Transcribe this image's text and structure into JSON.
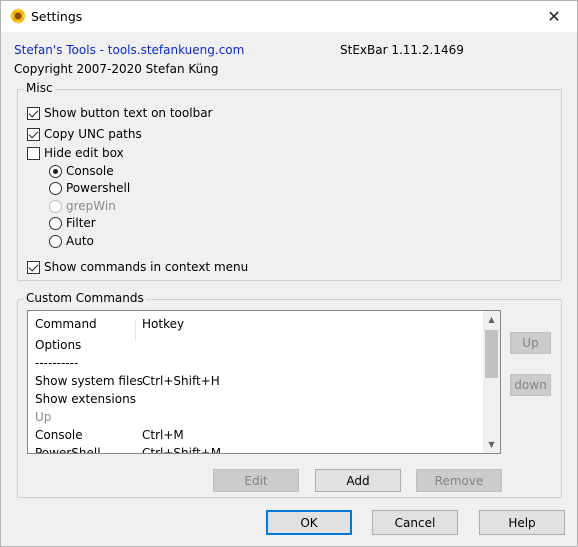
{
  "window": {
    "title": "Settings",
    "close_glyph": "✕"
  },
  "header": {
    "link": "Stefan's Tools - tools.stefankueng.com",
    "version": "StExBar 1.11.2.1469",
    "copyright": "Copyright 2007-2020 Stefan Küng"
  },
  "misc": {
    "label": "Misc",
    "show_button_text": {
      "label": "Show button text on toolbar",
      "checked": true
    },
    "copy_unc": {
      "label": "Copy UNC paths",
      "checked": true
    },
    "hide_edit": {
      "label": "Hide edit box",
      "checked": false
    },
    "radios": [
      {
        "label": "Console",
        "checked": true,
        "enabled": true
      },
      {
        "label": "Powershell",
        "checked": false,
        "enabled": true
      },
      {
        "label": "grepWin",
        "checked": false,
        "enabled": false
      },
      {
        "label": "Filter",
        "checked": false,
        "enabled": true
      },
      {
        "label": "Auto",
        "checked": false,
        "enabled": true
      }
    ],
    "show_commands": {
      "label": "Show commands in context menu",
      "checked": true
    }
  },
  "custom": {
    "label": "Custom Commands",
    "header": {
      "col1": "Command",
      "col2": "Hotkey"
    },
    "rows": [
      {
        "command": "Options",
        "hotkey": ""
      },
      {
        "command": "----------",
        "hotkey": ""
      },
      {
        "command": "Show system files",
        "hotkey": "Ctrl+Shift+H"
      },
      {
        "command": "Show extensions",
        "hotkey": ""
      },
      {
        "command": "Up",
        "hotkey": ""
      },
      {
        "command": "Console",
        "hotkey": "Ctrl+M"
      },
      {
        "command": "PowerShell",
        "hotkey": "Ctrl+Shift+M"
      }
    ],
    "up_label": "Up",
    "down_label": "down",
    "edit_label": "Edit",
    "add_label": "Add",
    "remove_label": "Remove"
  },
  "footer": {
    "ok_label": "OK",
    "cancel_label": "Cancel",
    "help_label": "Help"
  },
  "colors": {
    "link": "#0b2bd0",
    "accent": "#0078d7",
    "icon_yellow": "#f2b705"
  }
}
